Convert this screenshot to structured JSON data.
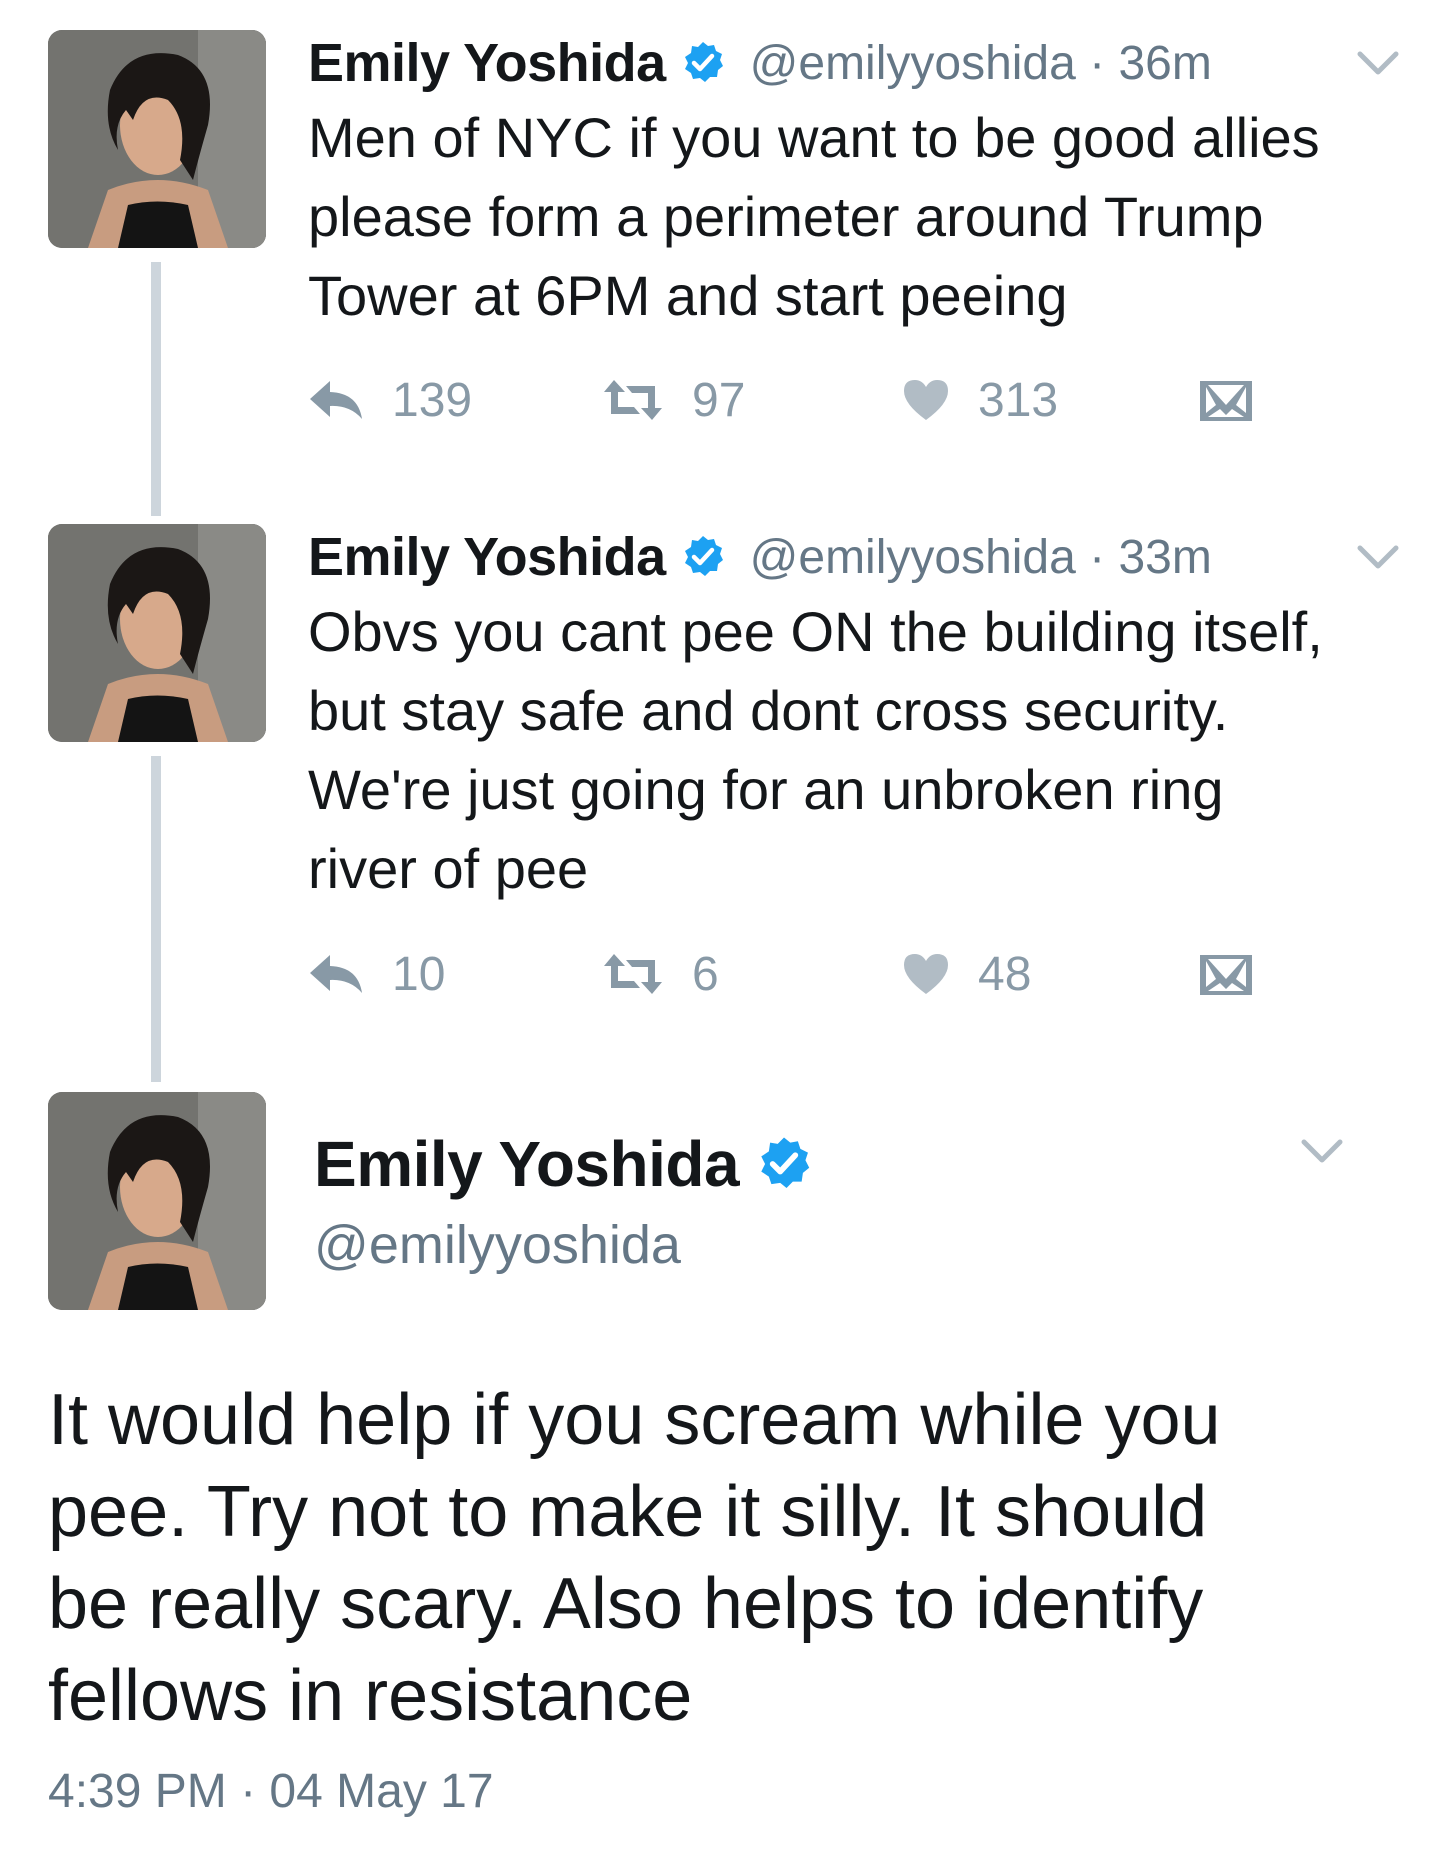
{
  "tweets": [
    {
      "name": "Emily Yoshida",
      "handle_time": "@emilyyoshida · 36m",
      "text_lines": [
        "Men of NYC if you want to be good allies",
        "please form a perimeter around Trump",
        "Tower at 6PM and start peeing"
      ],
      "replies": "139",
      "retweets": "97",
      "likes": "313"
    },
    {
      "name": "Emily Yoshida",
      "handle_time": "@emilyyoshida · 33m",
      "text_lines": [
        "Obvs you cant pee ON the building itself,",
        "but stay safe and dont cross security.",
        "We're just going for an unbroken ring",
        "river of pee"
      ],
      "replies": "10",
      "retweets": "6",
      "likes": "48"
    }
  ],
  "main_tweet": {
    "name": "Emily Yoshida",
    "handle": "@emilyyoshida",
    "text_lines": [
      "It would help if you scream while you",
      "pee. Try not to make it silly. It should",
      "be really scary. Also helps to identify",
      "fellows in resistance"
    ],
    "timestamp": "4:39 PM · 04 May 17"
  },
  "icons": {
    "verified": "verified-badge-icon",
    "reply": "reply-icon",
    "retweet": "retweet-icon",
    "like": "heart-icon",
    "dm": "envelope-icon",
    "menu": "chevron-down-icon"
  },
  "colors": {
    "verified_blue": "#1da1f2",
    "action_gray": "#8899a6",
    "handle_gray": "#657786",
    "thread_line": "#cdd5dc",
    "text": "#14171a"
  }
}
